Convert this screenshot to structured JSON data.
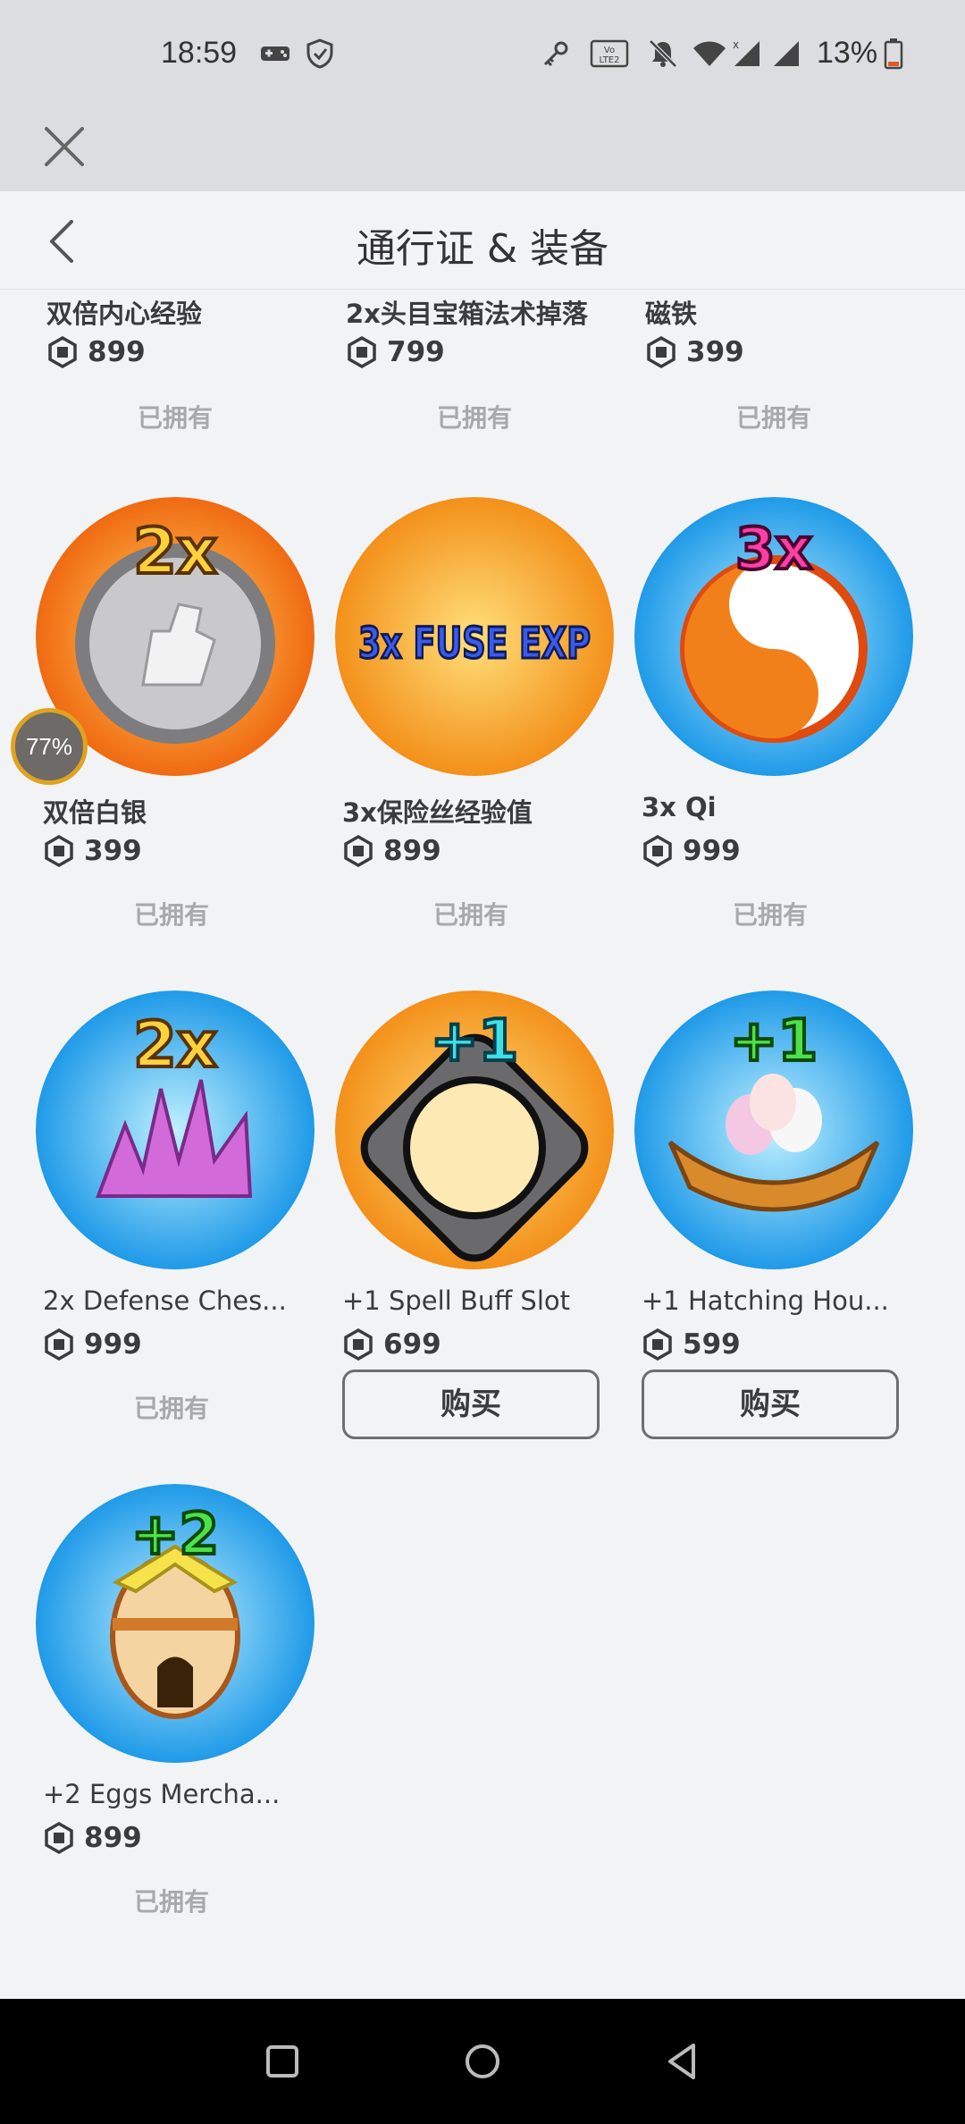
{
  "status_bar": {
    "time": "18:59",
    "battery_percent": "13%",
    "icons": [
      "gamepad-icon",
      "shield-check-icon",
      "key-icon",
      "volte-icon",
      "bell-off-icon",
      "wifi-icon",
      "signal-icon",
      "signal-icon",
      "battery-low-icon"
    ],
    "volte_label": "Vo LTE 2"
  },
  "close_bar": {
    "close_icon": "close-icon"
  },
  "header": {
    "title": "通行证 & 装备",
    "back_icon": "chevron-left-icon"
  },
  "items": [
    {
      "name": "双倍内心经验",
      "price": "899",
      "status": "已拥有",
      "owned": true
    },
    {
      "name": "2x头目宝箱法术掉落",
      "price": "799",
      "status": "已拥有",
      "owned": true
    },
    {
      "name": "磁铁",
      "price": "399",
      "status": "已拥有",
      "owned": true
    },
    {
      "name": "双倍白银",
      "price": "399",
      "status": "已拥有",
      "owned": true,
      "badge_text": "2x"
    },
    {
      "name": "3x保险丝经验值",
      "price": "899",
      "status": "已拥有",
      "owned": true,
      "badge_text": "3x FUSE EXP"
    },
    {
      "name": "3x Qi",
      "price": "999",
      "status": "已拥有",
      "owned": true,
      "badge_text": "3x"
    },
    {
      "name": "2x Defense Ches...",
      "price": "999",
      "status": "已拥有",
      "owned": true,
      "badge_text": "2x"
    },
    {
      "name": "+1 Spell Buff Slot",
      "price": "699",
      "status": "购买",
      "owned": false,
      "badge_text": "+1"
    },
    {
      "name": "+1 Hatching Hou...",
      "price": "599",
      "status": "购买",
      "owned": false,
      "badge_text": "+1"
    },
    {
      "name": "+2 Eggs Mercha...",
      "price": "899",
      "status": "已拥有",
      "owned": true,
      "badge_text": "+2"
    }
  ],
  "overlay_progress": "77%",
  "nav_bar": {
    "icons": [
      "recent-apps-icon",
      "home-icon",
      "back-icon"
    ]
  },
  "colors": {
    "orange_bg": "#f29a1f",
    "blue_bg": "#2a9bf0",
    "owned_text": "#a8a9ab",
    "buy_border": "#6d6e70"
  }
}
